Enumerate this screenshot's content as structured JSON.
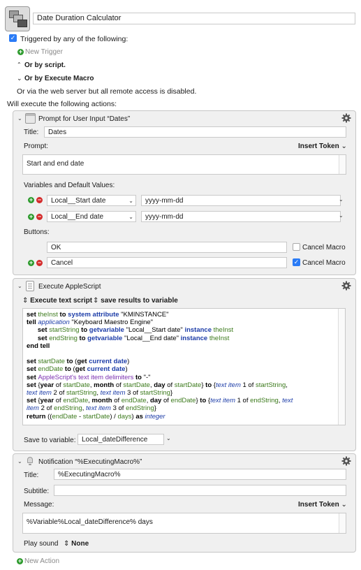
{
  "macro": {
    "name": "Date Duration Calculator"
  },
  "triggers": {
    "triggered_label": "Triggered by any of the following:",
    "new_trigger": "New Trigger",
    "or_by_script": "Or by script.",
    "or_by_execute_macro": "Or by Execute Macro",
    "web_server_note": "Or via the web server but all remote access is disabled."
  },
  "actions_heading": "Will execute the following actions:",
  "prompt_action": {
    "title": "Prompt for User Input “Dates”",
    "title_label": "Title:",
    "title_value": "Dates",
    "prompt_label": "Prompt:",
    "insert_token": "Insert Token",
    "prompt_value": "Start and end date",
    "vars_label": "Variables and Default Values:",
    "variables": [
      {
        "name": "Local__Start date",
        "default": "yyyy-mm-dd"
      },
      {
        "name": "Local__End date",
        "default": "yyyy-mm-dd"
      }
    ],
    "buttons_label": "Buttons:",
    "buttons": [
      {
        "label": "OK",
        "cancel_label": "Cancel Macro",
        "cancel_checked": false
      },
      {
        "label": "Cancel",
        "cancel_label": "Cancel Macro",
        "cancel_checked": true
      }
    ]
  },
  "applescript_action": {
    "title": "Execute AppleScript",
    "execute_mode": "Execute text script",
    "save_mode": "save results to variable",
    "code_lines": [
      [
        [
          "kw",
          "set "
        ],
        [
          "var",
          "theInst"
        ],
        [
          "kw",
          " to "
        ],
        [
          "kwb",
          "system attribute"
        ],
        [
          "str",
          " \"KMINSTANCE\""
        ]
      ],
      [
        [
          "kw",
          "tell "
        ],
        [
          "app",
          "application"
        ],
        [
          "str",
          " \"Keyboard Maestro Engine\""
        ]
      ],
      [
        [
          "str",
          "      "
        ],
        [
          "kw",
          "set "
        ],
        [
          "var",
          "startString"
        ],
        [
          "kw",
          " to "
        ],
        [
          "kwb",
          "getvariable"
        ],
        [
          "str",
          " \"Local__Start date\" "
        ],
        [
          "kwb",
          "instance"
        ],
        [
          "str",
          " "
        ],
        [
          "var",
          "theInst"
        ]
      ],
      [
        [
          "str",
          "      "
        ],
        [
          "kw",
          "set "
        ],
        [
          "var",
          "endString"
        ],
        [
          "kw",
          " to "
        ],
        [
          "kwb",
          "getvariable"
        ],
        [
          "str",
          " \"Local__End date\" "
        ],
        [
          "kwb",
          "instance"
        ],
        [
          "str",
          " "
        ],
        [
          "var",
          "theInst"
        ]
      ],
      [
        [
          "kw",
          "end tell"
        ]
      ],
      [
        [
          "str",
          " "
        ]
      ],
      [
        [
          "kw",
          "set "
        ],
        [
          "var",
          "startDate"
        ],
        [
          "kw",
          " to "
        ],
        [
          "str",
          "("
        ],
        [
          "kw",
          "get "
        ],
        [
          "kwb",
          "current date"
        ],
        [
          "str",
          ")"
        ]
      ],
      [
        [
          "kw",
          "set "
        ],
        [
          "var",
          "endDate"
        ],
        [
          "kw",
          " to "
        ],
        [
          "str",
          "("
        ],
        [
          "kw",
          "get "
        ],
        [
          "kwb",
          "current date"
        ],
        [
          "str",
          ")"
        ]
      ],
      [
        [
          "kw",
          "set "
        ],
        [
          "prop",
          "AppleScript's text item delimiters"
        ],
        [
          "kw",
          " to "
        ],
        [
          "str",
          "\"-\""
        ]
      ],
      [
        [
          "kw",
          "set "
        ],
        [
          "str",
          "{"
        ],
        [
          "kw",
          "year"
        ],
        [
          "str",
          " of "
        ],
        [
          "var",
          "startDate"
        ],
        [
          "str",
          ", "
        ],
        [
          "kw",
          "month"
        ],
        [
          "str",
          " of "
        ],
        [
          "var",
          "startDate"
        ],
        [
          "str",
          ", "
        ],
        [
          "kw",
          "day"
        ],
        [
          "str",
          " of "
        ],
        [
          "var",
          "startDate"
        ],
        [
          "str",
          "} "
        ],
        [
          "kw",
          "to "
        ],
        [
          "str",
          "{"
        ],
        [
          "cls",
          "text item"
        ],
        [
          "str",
          " 1 of "
        ],
        [
          "var",
          "startString"
        ],
        [
          "str",
          ","
        ]
      ],
      [
        [
          "cls",
          "text item"
        ],
        [
          "str",
          " 2 of "
        ],
        [
          "var",
          "startString"
        ],
        [
          "str",
          ", "
        ],
        [
          "cls",
          "text item"
        ],
        [
          "str",
          " 3 of "
        ],
        [
          "var",
          "startString"
        ],
        [
          "str",
          "}"
        ]
      ],
      [
        [
          "kw",
          "set "
        ],
        [
          "str",
          "{"
        ],
        [
          "kw",
          "year"
        ],
        [
          "str",
          " of "
        ],
        [
          "var",
          "endDate"
        ],
        [
          "str",
          ", "
        ],
        [
          "kw",
          "month"
        ],
        [
          "str",
          " of "
        ],
        [
          "var",
          "endDate"
        ],
        [
          "str",
          ", "
        ],
        [
          "kw",
          "day"
        ],
        [
          "str",
          " of "
        ],
        [
          "var",
          "endDate"
        ],
        [
          "str",
          "} "
        ],
        [
          "kw",
          "to "
        ],
        [
          "str",
          "{"
        ],
        [
          "cls",
          "text item"
        ],
        [
          "str",
          " 1 of "
        ],
        [
          "var",
          "endString"
        ],
        [
          "str",
          ", "
        ],
        [
          "cls",
          "text"
        ]
      ],
      [
        [
          "cls",
          "item"
        ],
        [
          "str",
          " 2 of "
        ],
        [
          "var",
          "endString"
        ],
        [
          "str",
          ", "
        ],
        [
          "cls",
          "text item"
        ],
        [
          "str",
          " 3 of "
        ],
        [
          "var",
          "endString"
        ],
        [
          "str",
          "}"
        ]
      ],
      [
        [
          "kw",
          "return "
        ],
        [
          "str",
          "(("
        ],
        [
          "var",
          "endDate"
        ],
        [
          "str",
          " - "
        ],
        [
          "var",
          "startDate"
        ],
        [
          "str",
          ") / "
        ],
        [
          "var",
          "days"
        ],
        [
          "str",
          ") "
        ],
        [
          "kw",
          "as "
        ],
        [
          "cls",
          "integer"
        ]
      ]
    ],
    "save_label": "Save to variable:",
    "save_variable": "Local_dateDifference"
  },
  "notification_action": {
    "title": "Notification “%ExecutingMacro%”",
    "title_label": "Title:",
    "title_value": "%ExecutingMacro%",
    "subtitle_label": "Subtitle:",
    "subtitle_value": "",
    "message_label": "Message:",
    "insert_token": "Insert Token",
    "message_value": "%Variable%Local_dateDifference% days",
    "sound_label": "Play sound",
    "sound_value": "None"
  },
  "new_action": "New Action",
  "colors": {
    "accent": "#2a7bf6",
    "add": "#2e9b2e",
    "remove": "#d42a2a",
    "panel": "#f0f0f0"
  }
}
